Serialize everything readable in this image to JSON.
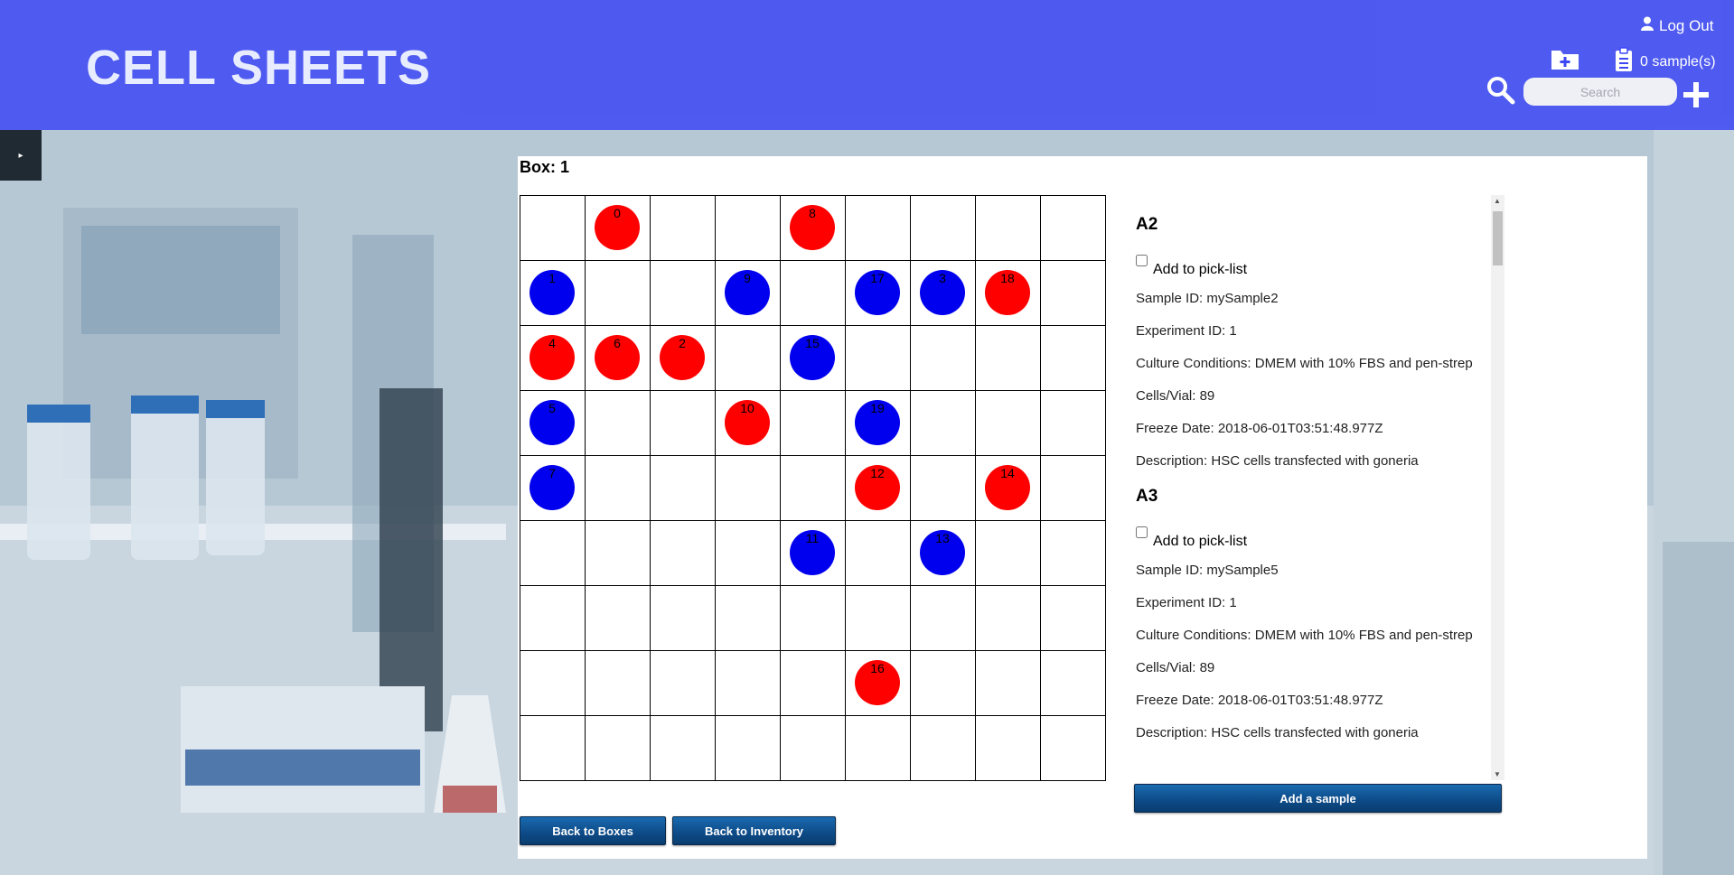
{
  "header": {
    "title": "CELL SHEETS",
    "logout_label": "Log Out",
    "samples_count": "0 sample(s)",
    "search_placeholder": "Search"
  },
  "box": {
    "title": "Box: 1",
    "rows": 9,
    "cols": 9,
    "vials": [
      {
        "label": "0",
        "row": 0,
        "col": 1,
        "color": "red"
      },
      {
        "label": "8",
        "row": 0,
        "col": 4,
        "color": "red"
      },
      {
        "label": "1",
        "row": 1,
        "col": 0,
        "color": "blue"
      },
      {
        "label": "9",
        "row": 1,
        "col": 3,
        "color": "blue"
      },
      {
        "label": "17",
        "row": 1,
        "col": 5,
        "color": "blue"
      },
      {
        "label": "3",
        "row": 1,
        "col": 6,
        "color": "blue"
      },
      {
        "label": "18",
        "row": 1,
        "col": 7,
        "color": "red"
      },
      {
        "label": "4",
        "row": 2,
        "col": 0,
        "color": "red"
      },
      {
        "label": "6",
        "row": 2,
        "col": 1,
        "color": "red"
      },
      {
        "label": "2",
        "row": 2,
        "col": 2,
        "color": "red"
      },
      {
        "label": "15",
        "row": 2,
        "col": 4,
        "color": "blue"
      },
      {
        "label": "5",
        "row": 3,
        "col": 0,
        "color": "blue"
      },
      {
        "label": "10",
        "row": 3,
        "col": 3,
        "color": "red"
      },
      {
        "label": "19",
        "row": 3,
        "col": 5,
        "color": "blue"
      },
      {
        "label": "7",
        "row": 4,
        "col": 0,
        "color": "blue"
      },
      {
        "label": "12",
        "row": 4,
        "col": 5,
        "color": "red"
      },
      {
        "label": "14",
        "row": 4,
        "col": 7,
        "color": "red"
      },
      {
        "label": "11",
        "row": 5,
        "col": 4,
        "color": "blue"
      },
      {
        "label": "13",
        "row": 5,
        "col": 6,
        "color": "blue"
      },
      {
        "label": "16",
        "row": 7,
        "col": 5,
        "color": "red"
      }
    ]
  },
  "details": [
    {
      "position": "A2",
      "pick_label": "Add to pick-list",
      "lines": [
        "Sample ID: mySample2",
        "Experiment ID: 1",
        "Culture Conditions: DMEM with 10% FBS and pen-strep",
        "Cells/Vial: 89",
        "Freeze Date: 2018-06-01T03:51:48.977Z",
        "Description: HSC cells transfected with goneria"
      ]
    },
    {
      "position": "A3",
      "pick_label": "Add to pick-list",
      "lines": [
        "Sample ID: mySample5",
        "Experiment ID: 1",
        "Culture Conditions: DMEM with 10% FBS and pen-strep",
        "Cells/Vial: 89",
        "Freeze Date: 2018-06-01T03:51:48.977Z",
        "Description: HSC cells transfected with goneria"
      ]
    }
  ],
  "buttons": {
    "add_sample": "Add a sample",
    "back_boxes": "Back to Boxes",
    "back_inventory": "Back to Inventory"
  },
  "colors": {
    "header_bg": "#3c46f5",
    "vial_red": "#ff0000",
    "vial_blue": "#0000ee",
    "button": "#0d4a86"
  },
  "icons": [
    "user-icon",
    "add-folder-icon",
    "clipboard-icon",
    "search-icon",
    "plus-icon",
    "sidebar-toggle-icon"
  ]
}
